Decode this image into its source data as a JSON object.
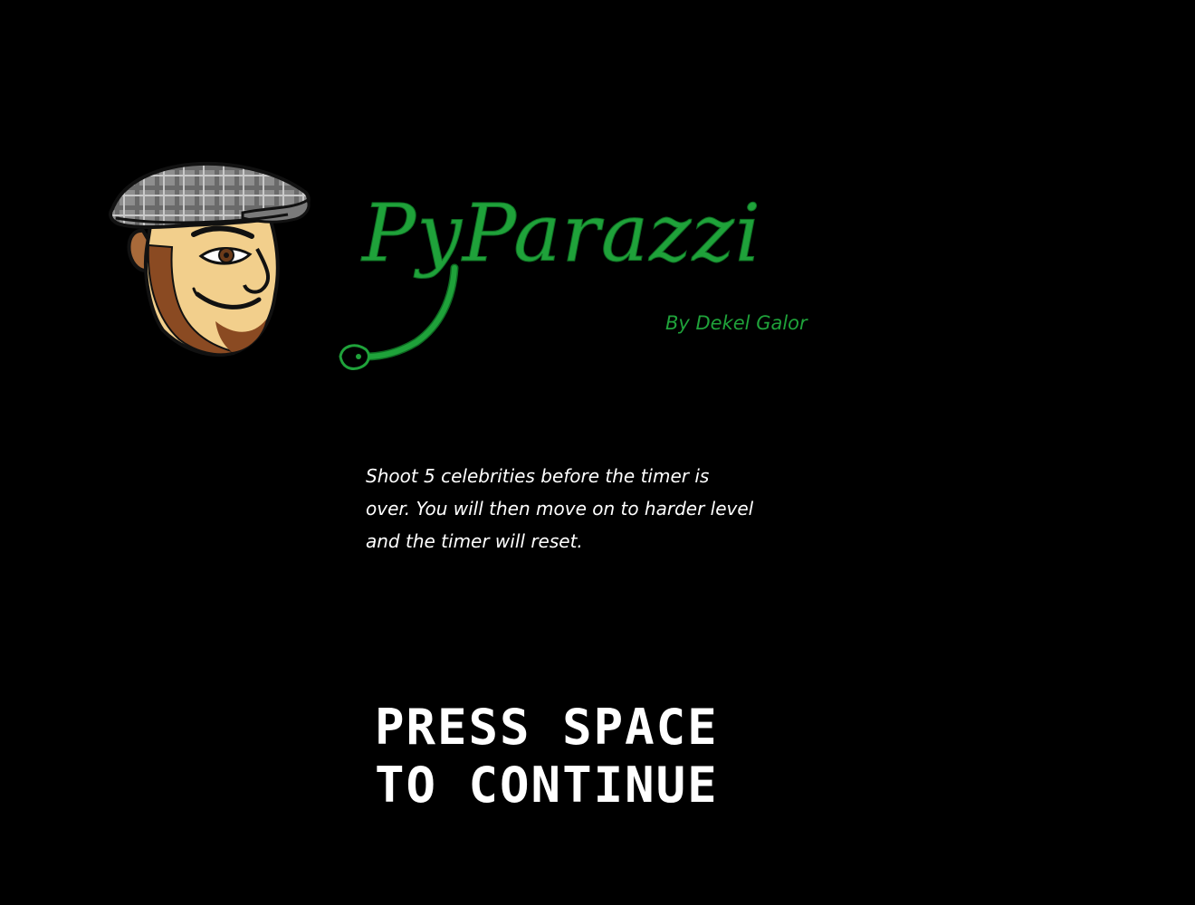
{
  "title_screen": {
    "game_title": "PyParazzi",
    "byline": "By Dekel Galor",
    "instructions": "Shoot 5 celebrities before the timer is over. You will then move on to harder level and the timer will reset.",
    "prompt_line_1": "PRESS SPACE",
    "prompt_line_2": "TO CONTINUE"
  },
  "mascot": {
    "icon": "paparazzi-cartoon-face-with-flat-cap"
  },
  "colors": {
    "background": "#000000",
    "title_green": "#1fa23a",
    "text": "#ffffff"
  }
}
